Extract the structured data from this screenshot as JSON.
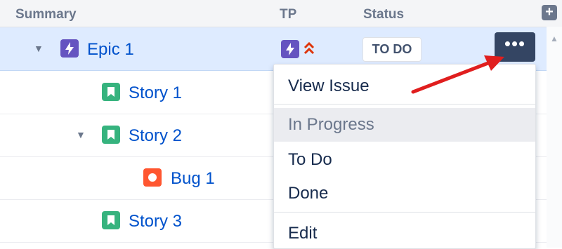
{
  "header": {
    "summary_label": "Summary",
    "tp_label": "TP",
    "status_label": "Status",
    "add_icon": "plus-icon"
  },
  "rows": [
    {
      "label": "Epic 1",
      "type": "epic",
      "icon": "epic-lightning-icon",
      "color": "#6554c0",
      "expanded": true,
      "selected": true
    },
    {
      "label": "Story 1",
      "type": "story",
      "icon": "story-bookmark-icon",
      "color": "#36b37e"
    },
    {
      "label": "Story 2",
      "type": "story",
      "icon": "story-bookmark-icon",
      "color": "#36b37e",
      "expanded": true
    },
    {
      "label": "Bug 1",
      "type": "bug",
      "icon": "bug-circle-icon",
      "color": "#ff5630"
    },
    {
      "label": "Story 3",
      "type": "story",
      "icon": "story-bookmark-icon",
      "color": "#36b37e"
    }
  ],
  "epic_row": {
    "tp_icon": "epic-lightning-icon",
    "priority_icon": "highest-priority-icon",
    "priority_color": "#de350b",
    "status": "TO DO",
    "more_label": "•••"
  },
  "menu": {
    "items": [
      {
        "label": "View Issue",
        "enabled": true
      },
      {
        "label": "In Progress",
        "enabled": false
      },
      {
        "label": "To Do",
        "enabled": true
      },
      {
        "label": "Done",
        "enabled": true
      },
      {
        "label": "Edit",
        "enabled": true
      }
    ]
  },
  "colors": {
    "link": "#0052cc",
    "selected_row": "#deebff",
    "more_button": "#344563",
    "annotation_arrow": "#e01e1e"
  }
}
